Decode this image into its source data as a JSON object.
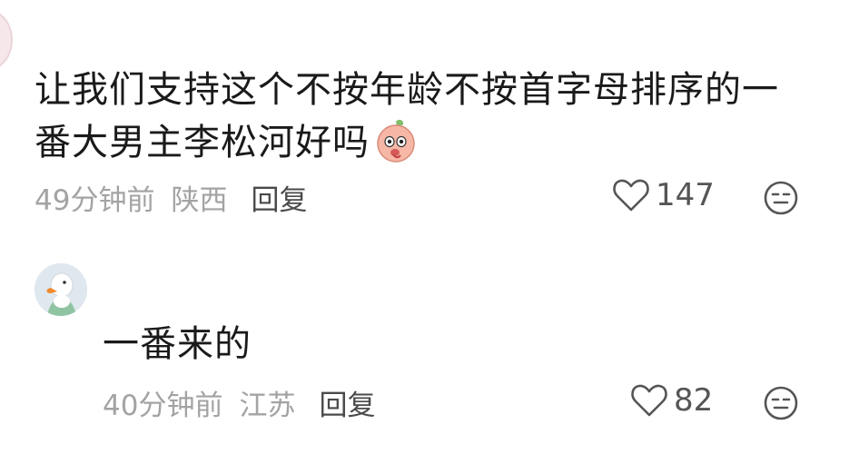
{
  "comments": [
    {
      "text": "让我们支持这个不按年龄不按首字母排序的一番大男主李松河好吗",
      "time": "49分钟前",
      "location": "陕西",
      "reply_label": "回复",
      "likes": "147",
      "emoji": "peach-emoji"
    },
    {
      "text": "一番来的",
      "time": "40分钟前",
      "location": "江苏",
      "reply_label": "回复",
      "likes": "82",
      "avatar": "duck-avatar"
    }
  ],
  "icons": {
    "like": "heart-outline-icon",
    "dislike": "neutral-face-icon"
  },
  "colors": {
    "text": "#1a1a1a",
    "meta": "#a3a3a3",
    "reply": "#4a4a4a",
    "icon": "#555555"
  }
}
